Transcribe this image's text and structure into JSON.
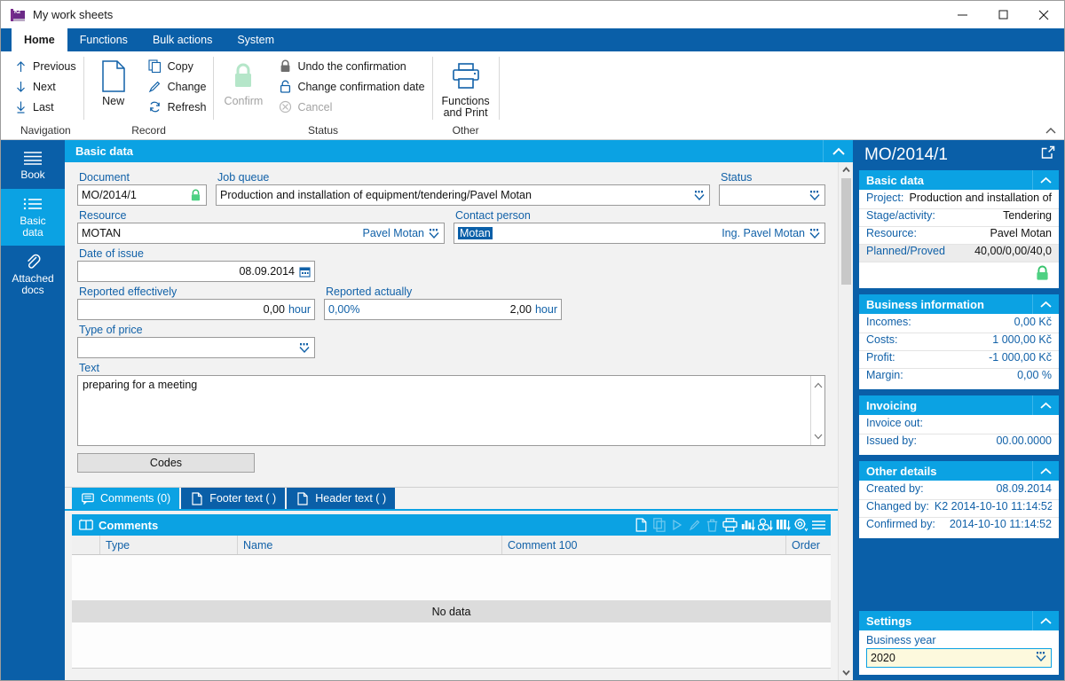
{
  "window": {
    "title": "My work sheets",
    "app_icon": "k2-logo-icon",
    "minimize": "—",
    "maximize": "□",
    "close": "✕"
  },
  "ribbon": {
    "tabs": [
      {
        "label": "Home",
        "active": true
      },
      {
        "label": "Functions",
        "active": false
      },
      {
        "label": "Bulk actions",
        "active": false
      },
      {
        "label": "System",
        "active": false
      }
    ],
    "groups": [
      {
        "label": "Navigation",
        "items": [
          {
            "label": "Previous",
            "icon": "arrow-up-icon",
            "disabled": false
          },
          {
            "label": "Next",
            "icon": "arrow-down-icon",
            "disabled": false
          },
          {
            "label": "Last",
            "icon": "arrow-down-bar-icon",
            "disabled": false
          }
        ]
      },
      {
        "label": "Record",
        "big": {
          "label": "New",
          "icon": "new-document-icon"
        },
        "items": [
          {
            "label": "Copy",
            "icon": "copy-icon",
            "disabled": false
          },
          {
            "label": "Change",
            "icon": "pencil-icon",
            "disabled": false
          },
          {
            "label": "Refresh",
            "icon": "refresh-icon",
            "disabled": false
          }
        ]
      },
      {
        "label": "Status",
        "big": {
          "label": "Confirm",
          "icon": "lock-green-icon",
          "disabled": true
        },
        "items": [
          {
            "label": "Undo the confirmation",
            "icon": "lock-gray-icon",
            "disabled": false
          },
          {
            "label": "Change confirmation date",
            "icon": "lock-open-blue-icon",
            "disabled": false
          },
          {
            "label": "Cancel",
            "icon": "cancel-circle-icon",
            "disabled": true
          }
        ]
      },
      {
        "label": "Other",
        "big": {
          "label": "Functions\nand Print",
          "label_line1": "Functions",
          "label_line2": "and Print",
          "icon": "printer-icon"
        }
      }
    ],
    "collapse_icon": "chevron-up-icon"
  },
  "leftnav": {
    "items": [
      {
        "label": "Book",
        "icon": "book-lines-icon",
        "active": false
      },
      {
        "label_line1": "Basic",
        "label_line2": "data",
        "icon": "list-icon",
        "active": true
      },
      {
        "label_line1": "Attached",
        "label_line2": "docs",
        "icon": "paperclip-icon",
        "active": false
      }
    ]
  },
  "form": {
    "panel_title": "Basic data",
    "panel_chevron": "chevron-up-icon",
    "document": {
      "label": "Document",
      "value": "MO/2014/1",
      "lock_icon": "lock-green-icon"
    },
    "job_queue": {
      "label": "Job queue",
      "value": "Production and installation of equipment/tendering/Pavel Motan",
      "dropdown_icon": "lookup-dropdown-icon"
    },
    "status": {
      "label": "Status",
      "value": "",
      "dropdown_icon": "lookup-dropdown-icon"
    },
    "resource": {
      "label": "Resource",
      "value": "MOTAN",
      "value2": "Pavel Motan",
      "dropdown_icon": "lookup-dropdown-icon"
    },
    "contact_person": {
      "label": "Contact person",
      "value": "Motan",
      "value2": "Ing. Pavel Motan",
      "dropdown_icon": "lookup-dropdown-icon",
      "selected": true
    },
    "date_of_issue": {
      "label": "Date of issue",
      "value": "08.09.2014",
      "calendar_icon": "calendar-icon"
    },
    "reported_effectively": {
      "label": "Reported effectively",
      "value": "0,00",
      "unit": "hour"
    },
    "reported_actually": {
      "label": "Reported actually",
      "prefix": "0,00%",
      "value": "2,00",
      "unit": "hour"
    },
    "type_of_price": {
      "label": "Type of price",
      "value": "",
      "dropdown_icon": "lookup-dropdown-icon"
    },
    "text": {
      "label": "Text",
      "value": "preparing for a meeting",
      "scroll_up_icon": "chevron-up-icon",
      "scroll_down_icon": "chevron-down-icon"
    },
    "codes_button": "Codes"
  },
  "subtabs": [
    {
      "label": "Comments (0)",
      "icon": "comment-icon",
      "active": true
    },
    {
      "label": "Footer text ( )",
      "icon": "document-icon",
      "active": false
    },
    {
      "label": "Header text ( )",
      "icon": "document-icon",
      "active": false
    }
  ],
  "grid": {
    "title": "Comments",
    "title_icon": "book-open-icon",
    "tools": [
      {
        "name": "new-record-icon",
        "disabled": false
      },
      {
        "name": "copy-record-icon",
        "disabled": true
      },
      {
        "name": "run-icon",
        "disabled": true
      },
      {
        "name": "edit-pencil-icon",
        "disabled": true
      },
      {
        "name": "delete-trash-icon",
        "disabled": true
      },
      {
        "name": "print-icon",
        "disabled": false
      },
      {
        "name": "chart-icon",
        "disabled": false
      },
      {
        "name": "pivot-icon",
        "disabled": false
      },
      {
        "name": "columns-icon",
        "disabled": false
      },
      {
        "name": "settings-gear-icon",
        "disabled": false
      },
      {
        "name": "hamburger-menu-icon",
        "disabled": false
      }
    ],
    "columns": [
      "",
      "Type",
      "Name",
      "Comment 100",
      "Order"
    ],
    "rows": [],
    "empty_text": "No data"
  },
  "rightpanel": {
    "title": "MO/2014/1",
    "expand_icon": "external-link-icon",
    "sections": [
      {
        "title": "Basic data",
        "chevron": "chevron-up-icon",
        "rows": [
          {
            "key": "Project:",
            "value": "Production and installation of"
          },
          {
            "key": "Stage/activity:",
            "value": "Tendering"
          },
          {
            "key": "Resource:",
            "value": "Pavel Motan"
          },
          {
            "key": "Planned/Proved",
            "value": "40,00/0,00/40,0",
            "highlight": true
          }
        ],
        "lock_icon": "lock-green-icon"
      },
      {
        "title": "Business information",
        "chevron": "chevron-up-icon",
        "rows": [
          {
            "key": "Incomes:",
            "value": "0,00 Kč",
            "currency": true
          },
          {
            "key": "Costs:",
            "value": "1 000,00 Kč",
            "currency": true
          },
          {
            "key": "Profit:",
            "value": "-1 000,00 Kč",
            "currency": true
          },
          {
            "key": "Margin:",
            "value": "0,00 %",
            "currency": true
          }
        ]
      },
      {
        "title": "Invoicing",
        "chevron": "chevron-up-icon",
        "rows": [
          {
            "key": "Invoice out:",
            "value": ""
          },
          {
            "key": "Issued by:",
            "value": "00.00.0000",
            "currency": true
          }
        ]
      },
      {
        "title": "Other details",
        "chevron": "chevron-up-icon",
        "rows": [
          {
            "key": "Created by:",
            "value": "08.09.2014",
            "currency": true
          },
          {
            "key": "Changed by:",
            "value": "K2 2014-10-10 11:14:52",
            "currency": true
          },
          {
            "key": "Confirmed by:",
            "value": "2014-10-10 11:14:52",
            "currency": true
          }
        ]
      }
    ],
    "settings": {
      "title": "Settings",
      "chevron": "chevron-up-icon",
      "field_label": "Business year",
      "field_value": "2020",
      "dropdown_icon": "lookup-dropdown-icon"
    }
  },
  "colors": {
    "ribbon_blue": "#0a5fa8",
    "accent_cyan": "#0ba2e3",
    "label_blue": "#1161a8",
    "lock_green": "#5ed48c",
    "field_yellow": "#fdf9dd"
  }
}
